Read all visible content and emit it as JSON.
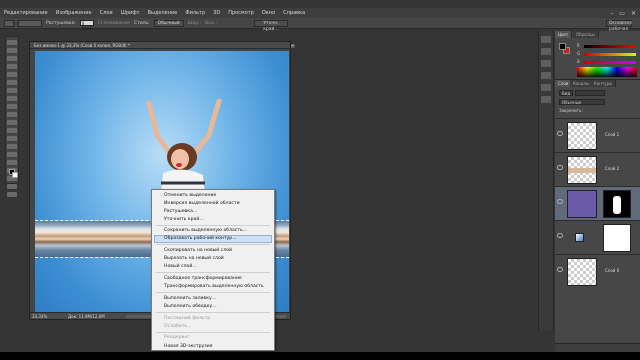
{
  "menubar": {
    "items": [
      "Редактирование",
      "Изображение",
      "Слои",
      "Шрифт",
      "Выделение",
      "Фильтр",
      "3D",
      "Просмотр",
      "Окно",
      "Справка"
    ],
    "window_controls": [
      "–",
      "▭",
      "✕"
    ]
  },
  "options_bar": {
    "feather_label": "Растушевка:",
    "feather_value": "0 пикс",
    "antialias_label": "Сглаживание",
    "style_label": "Стиль:",
    "style_value": "Обычный",
    "width_label": "Шир.:",
    "height_label": "Выс.:",
    "refine_edge": "Уточн. край...",
    "workspace": "Основная рабочая среда"
  },
  "document": {
    "title": "Без имени-1 @ 33,3% (Слой 0 копия, RGB/8) *",
    "controls": [
      "–",
      "▢",
      "✕"
    ],
    "zoom": "33,33%",
    "doc_size": "Док: 11,9M/12,0M"
  },
  "context_menu": {
    "items": [
      {
        "label": "Отменить выделение",
        "enabled": true
      },
      {
        "label": "Инверсия выделенной области",
        "enabled": true
      },
      {
        "label": "Растушевка...",
        "enabled": true
      },
      {
        "label": "Уточнить край...",
        "enabled": true
      },
      {
        "label": "Сохранить выделенную область...",
        "enabled": true
      },
      {
        "label": "Образовать рабочий контур...",
        "enabled": true,
        "highlighted": true
      },
      {
        "label": "Скопировать на новый слой",
        "enabled": true
      },
      {
        "label": "Вырезать на новый слой",
        "enabled": true
      },
      {
        "label": "Новый слой...",
        "enabled": true
      },
      {
        "label": "Свободное трансформирование",
        "enabled": true
      },
      {
        "label": "Трансформировать выделенную область",
        "enabled": true
      },
      {
        "label": "Выполнить заливку...",
        "enabled": true
      },
      {
        "label": "Выполнить обводку...",
        "enabled": true
      },
      {
        "label": "Последний фильтр",
        "enabled": false
      },
      {
        "label": "Ослабить...",
        "enabled": false
      },
      {
        "label": "Рендеринг",
        "enabled": false
      },
      {
        "label": "Новая 3D-экструзия",
        "enabled": true
      }
    ]
  },
  "color_panel": {
    "tabs": [
      "Цвет",
      "Образцы"
    ],
    "channels": [
      "R",
      "G",
      "B"
    ],
    "foreground": "#000000",
    "background": "#c8231e"
  },
  "layers_panel": {
    "tabs": [
      "Слои",
      "Каналы",
      "Контуры"
    ],
    "kind_filter": "Вид",
    "blend_mode": "Обычные",
    "lock_label": "Закрепить:",
    "layers": [
      {
        "name": "Слой 1",
        "selected": false,
        "type": "transparent"
      },
      {
        "name": "Слой 2",
        "selected": false,
        "type": "stripe"
      },
      {
        "name": "",
        "selected": true,
        "type": "photo-mask"
      },
      {
        "name": "",
        "selected": false,
        "type": "gradient-adjust"
      },
      {
        "name": "Слой 0",
        "selected": false,
        "type": "transparent"
      }
    ]
  }
}
